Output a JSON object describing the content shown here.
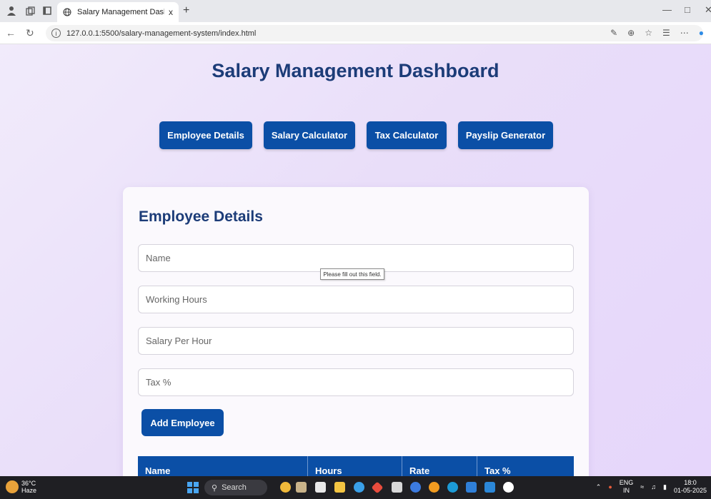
{
  "browser": {
    "tab_title": "Salary Management Dashboard",
    "tab_close": "x",
    "new_tab": "+",
    "url": "127.0.0.1:5500/salary-management-system/index.html"
  },
  "page": {
    "title": "Salary Management Dashboard",
    "nav_buttons": [
      "Employee Details",
      "Salary Calculator",
      "Tax Calculator",
      "Payslip Generator"
    ]
  },
  "form": {
    "title": "Employee Details",
    "placeholders": {
      "name": "Name",
      "hours": "Working Hours",
      "salary": "Salary Per Hour",
      "tax": "Tax %"
    },
    "validation_tooltip": "Please fill out this field.",
    "add_button": "Add Employee"
  },
  "table": {
    "headers": [
      "Name",
      "Hours",
      "Rate",
      "Tax %"
    ]
  },
  "taskbar": {
    "temperature": "36°C",
    "weather": "Haze",
    "search": "Search",
    "language_top": "ENG",
    "language_bottom": "IN",
    "time": "18:0",
    "date": "01-05-2025"
  },
  "colors": {
    "primary": "#0b4fa6",
    "heading": "#1c3c78"
  }
}
